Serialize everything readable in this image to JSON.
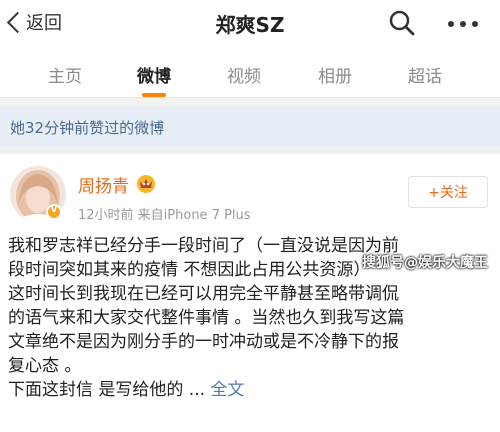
{
  "header": {
    "back_label": "返回",
    "title": "郑爽SZ"
  },
  "tabs": [
    {
      "label": "主页"
    },
    {
      "label": "微博"
    },
    {
      "label": "视频"
    },
    {
      "label": "相册"
    },
    {
      "label": "超话"
    }
  ],
  "notice": "她32分钟前赞过的微博",
  "post": {
    "author": "周扬青",
    "meta": "12小时前  来自iPhone 7 Plus",
    "follow_label": "+关注",
    "lines": [
      "我和罗志祥已经分手一段时间了（一直没说是因为前",
      "段时间突如其来的疫情 不想因此占用公共资源）",
      "这时间长到我现在已经可以用完全平静甚至略带调侃",
      "的语气来和大家交代整件事情 。当然也久到我写这篇",
      "文章绝不是因为刚分手的一时冲动或是不冷静下的报",
      "复心态 。"
    ],
    "last_line": "下面这封信 是写给他的 ... ",
    "more_link": "全文"
  },
  "watermark": "搜狐号@娱乐大魔王",
  "colors": {
    "accent": "#ff8200",
    "author": "#e86b1a",
    "link": "#4f7cb7",
    "notice_bg": "#e8eef6",
    "notice_text": "#4a6a93"
  }
}
